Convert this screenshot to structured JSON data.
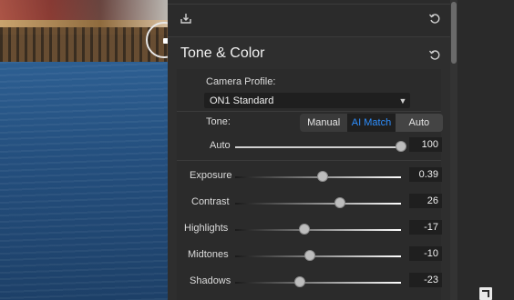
{
  "photo": {
    "name": "harbor-pier-photo"
  },
  "panel": {
    "section_title": "Tone & Color",
    "camera_profile_label": "Camera Profile:",
    "camera_profile_value": "ON1 Standard",
    "tone_label": "Tone:",
    "tone_modes": [
      "Manual",
      "AI Match",
      "Auto"
    ],
    "tone_mode_selected": "AI Match",
    "auto_slider": {
      "label": "Auto",
      "value": "100",
      "level": 1.0
    },
    "sliders": [
      {
        "label": "Exposure",
        "value": "0.39",
        "level": 0.53
      },
      {
        "label": "Contrast",
        "value": "26",
        "level": 0.63
      },
      {
        "label": "Highlights",
        "value": "-17",
        "level": 0.42
      },
      {
        "label": "Midtones",
        "value": "-10",
        "level": 0.45
      },
      {
        "label": "Shadows",
        "value": "-23",
        "level": 0.39
      }
    ]
  },
  "icons": {
    "export": "export-icon",
    "reset_top": "reset-icon",
    "reset_section": "reset-icon",
    "dropdown": "chevron-down-icon",
    "expand": "expand-icon"
  }
}
